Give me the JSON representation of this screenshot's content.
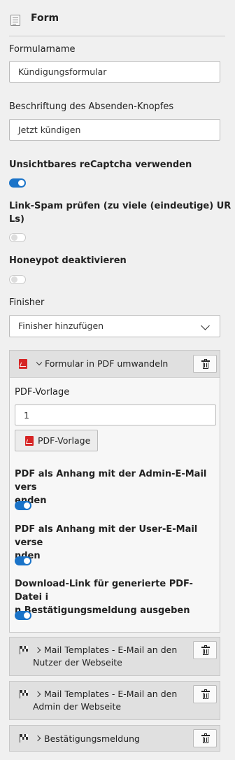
{
  "header": {
    "title": "Form",
    "icon": "form-icon"
  },
  "fields": {
    "formname": {
      "label": "Formularname",
      "value": "Kündigungsformular"
    },
    "submit_label": {
      "label": "Beschriftung des Absenden-Knopfes",
      "value": "Jetzt kündigen"
    }
  },
  "toggles": {
    "recaptcha": {
      "label": "Unsichtbares reCaptcha verwenden",
      "on": true
    },
    "linkspam": {
      "label": "Link-Spam prüfen (zu viele (eindeutige) URLs)",
      "line1": "Link-Spam prüfen (zu viele (eindeutige) UR",
      "line2": "Ls)",
      "on": false
    },
    "honeypot": {
      "label": "Honeypot deaktivieren",
      "on": false
    }
  },
  "finisher": {
    "label": "Finisher",
    "select_value": "Finisher hinzufügen"
  },
  "pdf_panel": {
    "title": "Formular in PDF umwandeln",
    "template_label": "PDF-Vorlage",
    "template_value": "1",
    "template_button": "PDF-Vorlage",
    "admin_attach": {
      "line1": "PDF als Anhang mit der Admin-E-Mail vers",
      "line2": "enden",
      "on": true
    },
    "user_attach": {
      "line1": "PDF als Anhang mit der User-E-Mail verse",
      "line2": "nden",
      "on": true
    },
    "download_link": {
      "line1": "Download-Link für generierte PDF-Datei i",
      "line2": "n Bestätigungsmeldung ausgeben",
      "on": true
    }
  },
  "collapsed_panels": [
    {
      "line1": "Mail Templates - E-Mail an den",
      "line2": "Nutzer der Webseite"
    },
    {
      "line1": "Mail Templates - E-Mail an den",
      "line2": "Admin der Webseite"
    },
    {
      "line1": "Bestätigungsmeldung",
      "line2": ""
    }
  ],
  "colors": {
    "toggle_on": "#1a73c8",
    "pdf_red": "#d62424",
    "panel_head": "#e0e0e0"
  }
}
